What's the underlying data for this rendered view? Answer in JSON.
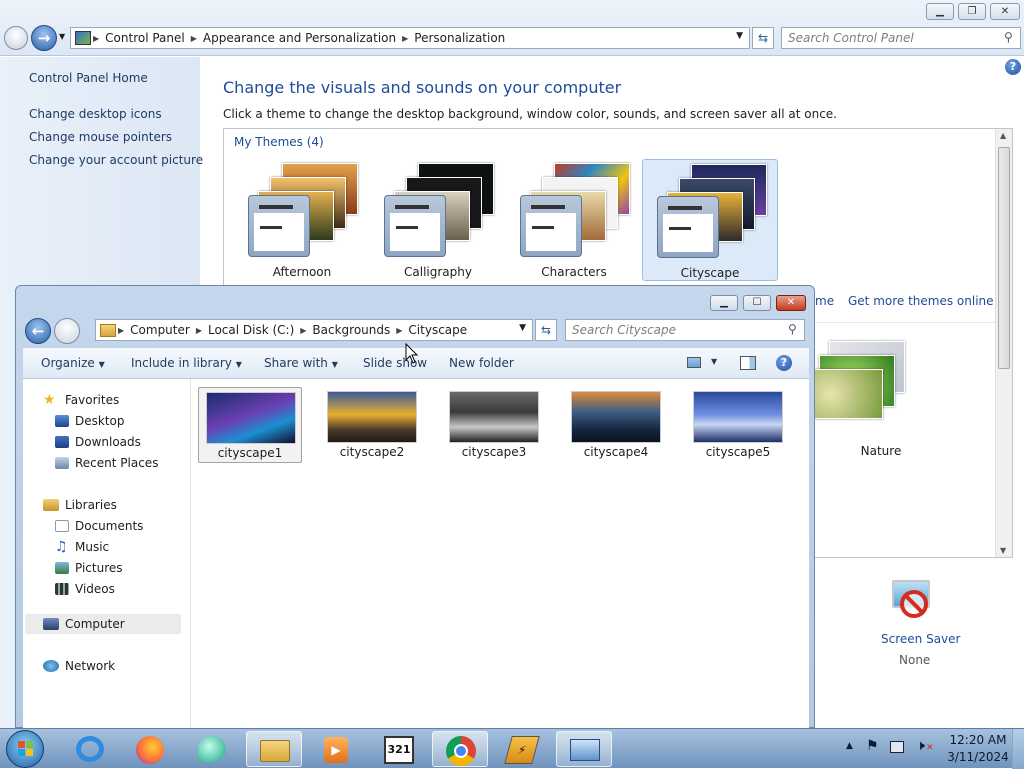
{
  "control_panel": {
    "breadcrumb": [
      "Control Panel",
      "Appearance and Personalization",
      "Personalization"
    ],
    "search_placeholder": "Search Control Panel",
    "sidebar": {
      "home": "Control Panel Home",
      "links": [
        "Change desktop icons",
        "Change mouse pointers",
        "Change your account picture"
      ]
    },
    "title": "Change the visuals and sounds on your computer",
    "subtitle": "Click a theme to change the desktop background, window color, sounds, and screen saver all at once.",
    "my_themes_label": "My Themes (4)",
    "themes": [
      "Afternoon",
      "Calligraphy",
      "Characters",
      "Cityscape"
    ],
    "save_theme_link_fragment": "me",
    "get_more_themes": "Get more themes online",
    "nature_theme": "Nature",
    "screen_saver": {
      "label": "Screen Saver",
      "value": "None"
    }
  },
  "explorer": {
    "breadcrumb": [
      "Computer",
      "Local Disk (C:)",
      "Backgrounds",
      "Cityscape"
    ],
    "search_placeholder": "Search Cityscape",
    "toolbar": {
      "organize": "Organize",
      "include_in_library": "Include in library",
      "share_with": "Share with",
      "slide_show": "Slide show",
      "new_folder": "New folder"
    },
    "nav": {
      "favorites": "Favorites",
      "favorites_items": [
        "Desktop",
        "Downloads",
        "Recent Places"
      ],
      "libraries": "Libraries",
      "libraries_items": [
        "Documents",
        "Music",
        "Pictures",
        "Videos"
      ],
      "computer": "Computer",
      "network": "Network"
    },
    "files": [
      "cityscape1",
      "cityscape2",
      "cityscape3",
      "cityscape4",
      "cityscape5"
    ]
  },
  "taskbar": {
    "time": "12:20 AM",
    "date": "3/11/2024"
  }
}
